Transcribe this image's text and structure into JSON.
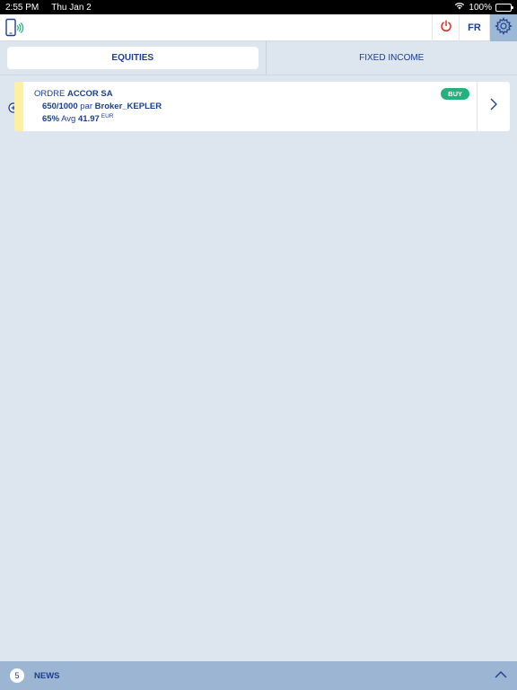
{
  "status_bar": {
    "time": "2:55 PM",
    "date": "Thu Jan 2",
    "battery": "100%"
  },
  "top_bar": {
    "language": "FR",
    "icons": [
      "phone-connect-icon",
      "power-icon",
      "gear-icon"
    ],
    "colors": {
      "power": "#e2231a",
      "settings_bg": "#9cb8d4"
    }
  },
  "tabs": [
    {
      "label": "EQUITIES",
      "active": true
    },
    {
      "label": "FIXED INCOME",
      "active": false
    }
  ],
  "order": {
    "prefix": "ORDRE",
    "instrument": "ACCOR SA",
    "side": "BUY",
    "quantity": "650/1000",
    "par_label": "par",
    "broker": "Broker_KEPLER",
    "percent": "65%",
    "avg_label": "Avg",
    "avg_price": "41.97",
    "currency": "EUR",
    "colors": {
      "stripe": "#fdf0a0",
      "buy": "#23b27d"
    }
  },
  "news": {
    "count": "5",
    "label": "NEWS"
  }
}
